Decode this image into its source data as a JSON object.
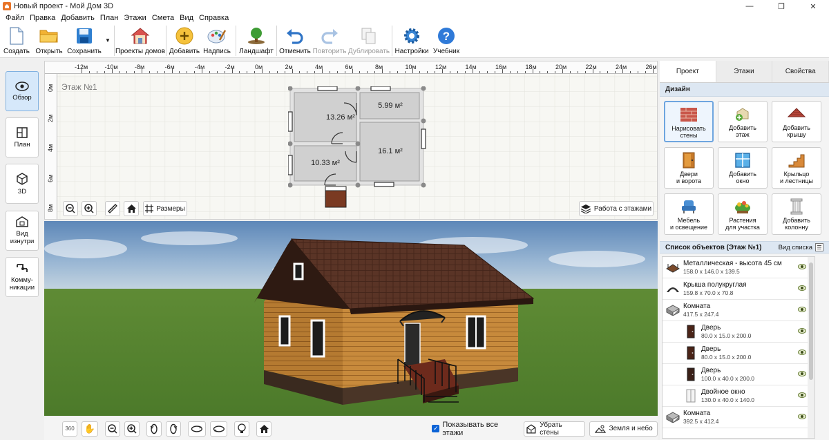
{
  "window": {
    "title": "Новый проект - Мой Дом 3D",
    "controls": [
      "minimize-icon",
      "restore-icon",
      "close-icon"
    ]
  },
  "menu": [
    "Файл",
    "Правка",
    "Добавить",
    "План",
    "Этажи",
    "Смета",
    "Вид",
    "Справка"
  ],
  "toolbar": {
    "create": "Создать",
    "open": "Открыть",
    "save": "Сохранить",
    "house_projects": "Проекты домов",
    "add": "Добавить",
    "caption": "Надпись",
    "landscape": "Ландшафт",
    "undo": "Отменить",
    "redo": "Повторить",
    "duplicate": "Дублировать",
    "settings": "Настройки",
    "tutorial": "Учебник"
  },
  "leftnav": {
    "overview": "Обзор",
    "plan": "План",
    "view3d": "3D",
    "inside_line1": "Вид",
    "inside_line2": "изнутри",
    "comm_line1": "Комму-",
    "comm_line2": "никации"
  },
  "plan": {
    "floor_label": "Этаж №1",
    "ruler_x": [
      "-12м",
      "-10м",
      "-8м",
      "-6м",
      "-4м",
      "-2м",
      "0м",
      "2м",
      "4м",
      "6м",
      "8м",
      "10м",
      "12м",
      "14м",
      "16м",
      "18м",
      "20м",
      "22м",
      "24м",
      "26м"
    ],
    "ruler_y": [
      "0м",
      "2м",
      "4м",
      "6м",
      "8м"
    ],
    "rooms": [
      {
        "area": "13.26 м²"
      },
      {
        "area": "5.99 м²"
      },
      {
        "area": "10.33 м²"
      },
      {
        "area": "16.1 м²"
      }
    ],
    "dimensions_button": "Размеры",
    "floors_button": "Работа с этажами"
  },
  "bottombar": {
    "show_all_floors": "Показывать все этажи",
    "show_all_floors_checked": true,
    "remove_walls": "Убрать стены",
    "earth_sky": "Земля и небо"
  },
  "rightpanel": {
    "tabs": [
      "Проект",
      "Этажи",
      "Свойства"
    ],
    "active_tab": "Проект",
    "design_header": "Дизайн",
    "design_buttons": [
      {
        "line1": "Нарисовать",
        "line2": "стены",
        "icon": "brick-wall-icon"
      },
      {
        "line1": "Добавить",
        "line2": "этаж",
        "icon": "add-floor-icon"
      },
      {
        "line1": "Добавить",
        "line2": "крышу",
        "icon": "roof-icon"
      },
      {
        "line1": "Двери",
        "line2": "и ворота",
        "icon": "door-icon"
      },
      {
        "line1": "Добавить",
        "line2": "окно",
        "icon": "window-icon"
      },
      {
        "line1": "Крыльцо",
        "line2": "и лестницы",
        "icon": "stairs-icon"
      },
      {
        "line1": "Мебель",
        "line2": "и освещение",
        "icon": "armchair-icon"
      },
      {
        "line1": "Растения",
        "line2": "для участка",
        "icon": "plant-icon"
      },
      {
        "line1": "Добавить",
        "line2": "колонну",
        "icon": "column-icon"
      }
    ],
    "objects_header": "Список объектов (Этаж №1)",
    "view_list": "Вид списка",
    "objects": [
      {
        "name": "Металлическая - высота 45 см",
        "dims": "158.0 x 146.0 x 139.5",
        "icon": "porch-icon",
        "child": false
      },
      {
        "name": "Крыша полукруглая",
        "dims": "159.8 x 70.0 x 70.8",
        "icon": "arch-roof-icon",
        "child": false
      },
      {
        "name": "Комната",
        "dims": "417.5 x 247.4",
        "icon": "room-icon",
        "child": false
      },
      {
        "name": "Дверь",
        "dims": "80.0 x 15.0 x 200.0",
        "icon": "door-icon",
        "child": true
      },
      {
        "name": "Дверь",
        "dims": "80.0 x 15.0 x 200.0",
        "icon": "door-icon",
        "child": true
      },
      {
        "name": "Дверь",
        "dims": "100.0 x 40.0 x 200.0",
        "icon": "door-icon",
        "child": true
      },
      {
        "name": "Двойное окно",
        "dims": "130.0 x 40.0 x 140.0",
        "icon": "double-window-icon",
        "child": true
      },
      {
        "name": "Комната",
        "dims": "392.5 x 412.4",
        "icon": "room-icon",
        "child": false
      }
    ]
  }
}
